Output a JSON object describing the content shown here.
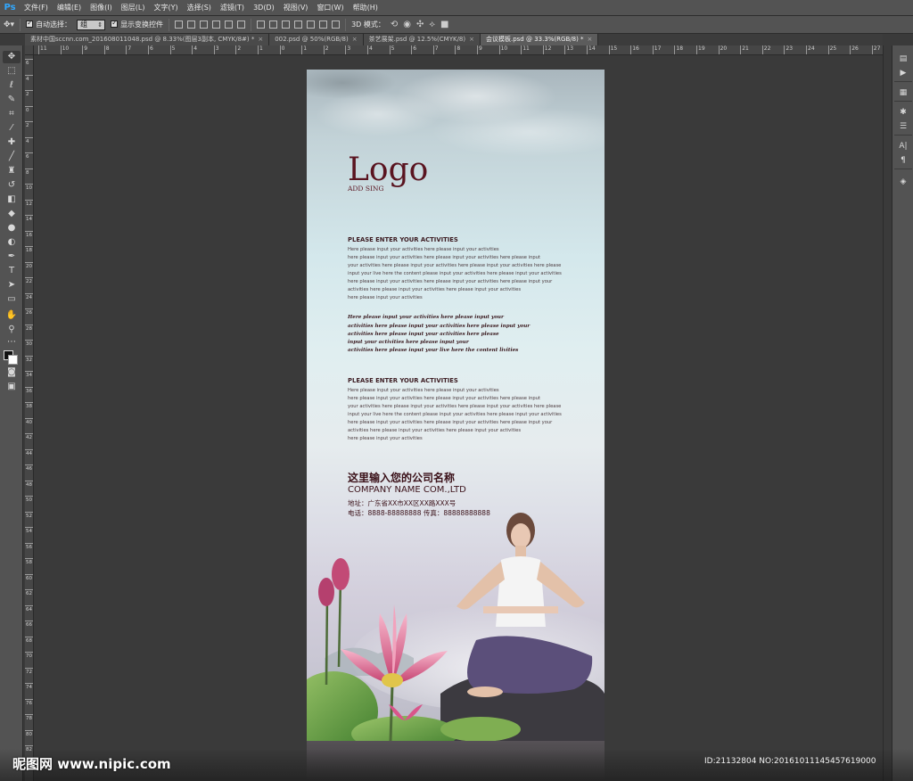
{
  "app": {
    "logo": "Ps",
    "menu": [
      "文件(F)",
      "编辑(E)",
      "图像(I)",
      "图层(L)",
      "文字(Y)",
      "选择(S)",
      "滤镜(T)",
      "3D(D)",
      "视图(V)",
      "窗口(W)",
      "帮助(H)"
    ]
  },
  "options_bar": {
    "auto_select_label": "自动选择：",
    "auto_select_value": "组",
    "show_transform_label": "显示变换控件",
    "mode_3d_label": "3D 模式："
  },
  "tabs": [
    {
      "label": "素材中国sccnn.com_201608011048.psd @ 8.33%(图层3副本, CMYK/8#) *"
    },
    {
      "label": "002.psd @ 50%(RGB/8)"
    },
    {
      "label": "茶艺展架.psd @ 12.5%(CMYK/8)"
    },
    {
      "label": "会议模板.psd @ 33.3%(RGB/8) *"
    }
  ],
  "ruler_h_labels": [
    "11",
    "10",
    "9",
    "8",
    "7",
    "6",
    "5",
    "4",
    "3",
    "2",
    "1",
    "0",
    "1",
    "2",
    "3",
    "4",
    "5",
    "6",
    "7",
    "8",
    "9",
    "10",
    "11",
    "12",
    "13",
    "14",
    "15",
    "16",
    "17",
    "18",
    "19",
    "20",
    "21",
    "22",
    "23",
    "24",
    "25",
    "26",
    "27"
  ],
  "ruler_v_labels": [
    "6",
    "4",
    "2",
    "0",
    "2",
    "4",
    "6",
    "8",
    "10",
    "12",
    "14",
    "16",
    "18",
    "20",
    "22",
    "24",
    "26",
    "28",
    "30",
    "32",
    "34",
    "36",
    "38",
    "40",
    "42",
    "44",
    "46",
    "48",
    "50",
    "52",
    "54",
    "56",
    "58",
    "60",
    "62",
    "64",
    "66",
    "68",
    "70",
    "72",
    "74",
    "76",
    "78",
    "80",
    "82",
    "84"
  ],
  "toolbar_icons": [
    "move-icon",
    "marquee-icon",
    "lasso-icon",
    "quick-select-icon",
    "crop-icon",
    "eyedropper-icon",
    "healing-brush-icon",
    "brush-icon",
    "clone-stamp-icon",
    "history-brush-icon",
    "eraser-icon",
    "paint-bucket-icon",
    "blur-icon",
    "dodge-icon",
    "pen-icon",
    "type-icon",
    "path-select-icon",
    "rectangle-icon",
    "hand-icon",
    "zoom-icon"
  ],
  "poster": {
    "logo": "Logo",
    "logo_sub": "ADD SING",
    "section1_title": "PLEASE ENTER YOUR ACTIVITIES",
    "section1_lines": [
      "Here please input your activities here please input your activities",
      "here please input your activities here please input your activities here please input",
      "your activities here please input your activities here please input your activities here please",
      "input your live here the content please input your activities here please input your activities",
      "here please input your activities here please input your activities here please input your",
      " activities here please input your activities here please input your activities",
      "here please input your activities"
    ],
    "script_lines": [
      "Here please input your activities here please input your",
      "activities here please input your activities here please input your",
      "activities here please input your activities here please",
      "input your activities here please input your",
      "activities here please input your live here the content livities"
    ],
    "section2_title": "PLEASE ENTER YOUR ACTIVITIES",
    "section2_lines": [
      "Here please input your activities here please input your activities",
      "here please input your activities here please input your activities here please input",
      "your activities here please input your activities here please input your activities here please",
      "input your live here the content please input your activities here please input your activities",
      "here please input your activities here please input your activities here please input your",
      " activities here please input your activities here please input your activities",
      "here please input your activities"
    ],
    "company_cn": "这里输入您的公司名称",
    "company_en": "COMPANY NAME COM.,LTD",
    "address": "地址：广东省XX市XX区XX路XXX号",
    "phone": "电话：8888-88888888  传真：88888888888"
  },
  "watermark": {
    "left": "昵图网 www.nipic.com",
    "right": "ID:21132804 NO:20161011145457619000"
  }
}
